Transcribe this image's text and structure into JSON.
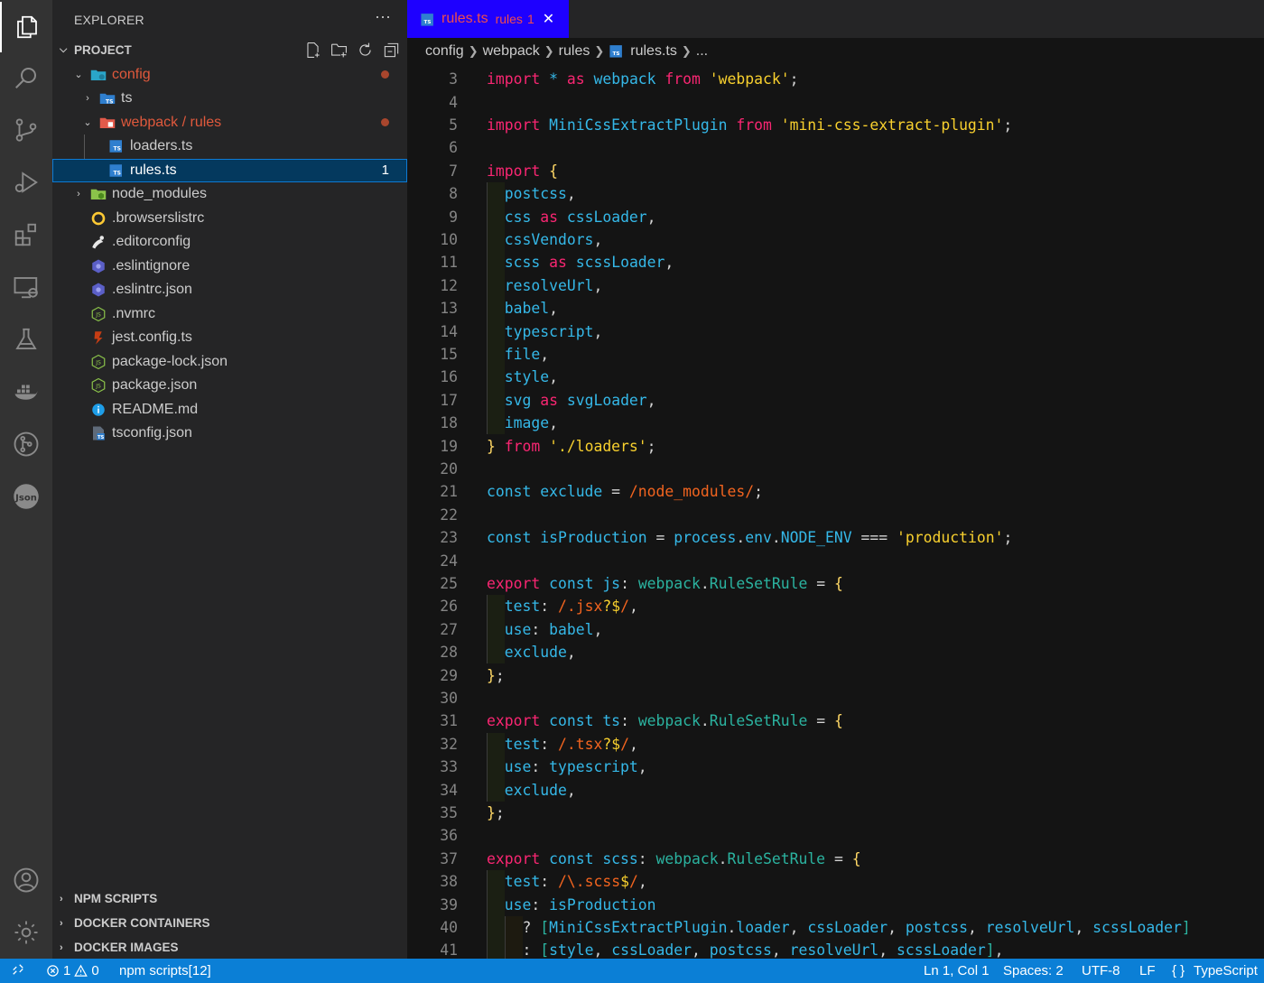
{
  "sidebar": {
    "title": "EXPLORER",
    "more": "···",
    "project_label": "PROJECT",
    "tree": [
      {
        "label": "config",
        "modified": true
      },
      {
        "label": "ts"
      },
      {
        "label": "webpack / rules",
        "modified": true
      },
      {
        "label": "loaders.ts"
      },
      {
        "label": "rules.ts",
        "badge": "1"
      },
      {
        "label": "node_modules"
      },
      {
        "label": ".browserslistrc"
      },
      {
        "label": ".editorconfig"
      },
      {
        "label": ".eslintignore"
      },
      {
        "label": ".eslintrc.json"
      },
      {
        "label": ".nvmrc"
      },
      {
        "label": "jest.config.ts"
      },
      {
        "label": "package-lock.json"
      },
      {
        "label": "package.json"
      },
      {
        "label": "README.md"
      },
      {
        "label": "tsconfig.json"
      }
    ],
    "sections": [
      "NPM SCRIPTS",
      "DOCKER CONTAINERS",
      "DOCKER IMAGES"
    ]
  },
  "tab": {
    "name": "rules.ts",
    "description": "rules",
    "problems": "1",
    "close": "✕"
  },
  "breadcrumb": {
    "items": [
      "config",
      "webpack",
      "rules"
    ],
    "file": "rules.ts",
    "tail": "..."
  },
  "code": {
    "line_numbers": [
      "3",
      "4",
      "5",
      "6",
      "7",
      "8",
      "9",
      "10",
      "11",
      "12",
      "13",
      "14",
      "15",
      "16",
      "17",
      "18",
      "19",
      "20",
      "21",
      "22",
      "23",
      "24",
      "25",
      "26",
      "27",
      "28",
      "29",
      "30",
      "31",
      "32",
      "33",
      "34",
      "35",
      "36",
      "37",
      "38",
      "39",
      "40",
      "41"
    ]
  },
  "status": {
    "errors": "1",
    "warnings": "0",
    "npm": "npm scripts[12]",
    "position": "Ln 1, Col 1",
    "spaces": "Spaces: 2",
    "encoding": "UTF-8",
    "eol": "LF",
    "language_icon": "{ }",
    "language": "TypeScript"
  },
  "colors": {
    "tab_active_bg": "#1e00ff",
    "status_bg": "#0b7fd6",
    "keyword": "#f92672",
    "identifier": "#35b8e8",
    "string": "#f8d02e",
    "regex": "#f2641f"
  }
}
